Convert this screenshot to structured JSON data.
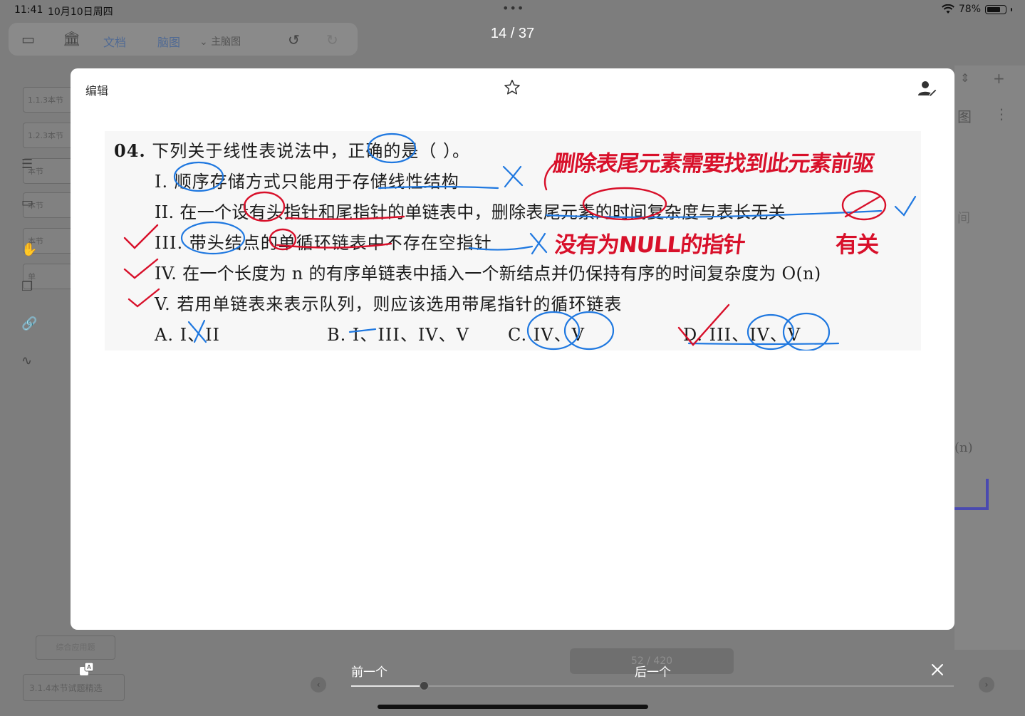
{
  "status_bar": {
    "time": "11:41",
    "date": "10月10日周四",
    "battery_percent": "78%",
    "battery_level": 0.78
  },
  "background_app": {
    "toolbar": {
      "doc_tab": "文档",
      "mindmap_tab": "脑图",
      "main_mindmap": "主脑图"
    },
    "sidebar_nodes": [
      "1.1.3本节",
      "1.2.3本节",
      "本节",
      "本节",
      "本节",
      "单"
    ],
    "comprehensive_node": "综合应用题",
    "section_node": "3.1.4本节试题精选",
    "bottom_counter": "52 / 420",
    "right_fragments": [
      "图",
      "间",
      "(n)"
    ]
  },
  "viewer": {
    "page_counter": "14 / 37",
    "edit_label": "编辑",
    "prev_label": "前一个",
    "next_label": "后一个",
    "progress": 0.12,
    "colors": {
      "red_ink": "#d8102a",
      "blue_ink": "#1f78e0",
      "overlay": "#7d7d7d"
    }
  },
  "question": {
    "number": "04.",
    "stem": "下列关于线性表说法中，正确的是（   ）。",
    "statements": [
      "I. 顺序存储方式只能用于存储线性结构",
      "II. 在一个设有头指针和尾指针的单链表中，删除表尾元素的时间复杂度与表长无关",
      "III. 带头结点的单循环链表中不存在空指针",
      "IV. 在一个长度为 n 的有序单链表中插入一个新结点并仍保持有序的时间复杂度为 O(n)",
      "V. 若用单链表来表示队列，则应该选用带尾指针的循环链表"
    ],
    "options": [
      {
        "label": "A. I、II"
      },
      {
        "label": "B. I、III、IV、V"
      },
      {
        "label": "C. IV、V"
      },
      {
        "label": "D. III、IV、V"
      }
    ],
    "annotations": {
      "note_top": "删除表尾元素需要找到此元素前驱",
      "note_mid": "没有为NULL的指针",
      "note_right": "有关"
    }
  }
}
